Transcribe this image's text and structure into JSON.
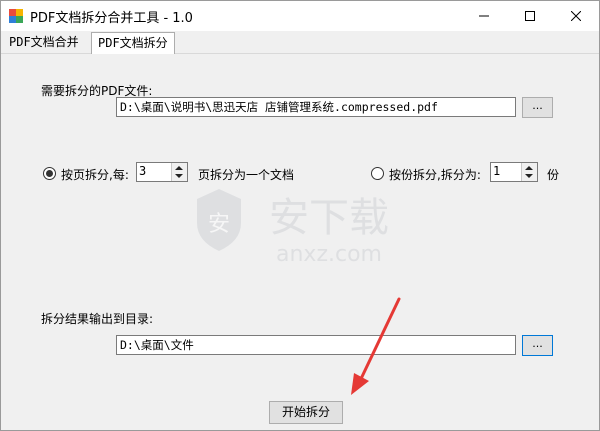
{
  "window": {
    "title": "PDF文档拆分合并工具 - 1.0"
  },
  "tabs": [
    {
      "label": "PDF文档合并",
      "active": false
    },
    {
      "label": "PDF文档拆分",
      "active": true
    }
  ],
  "source": {
    "label": "需要拆分的PDF文件:",
    "value": "D:\\桌面\\说明书\\思迅天店 店铺管理系统.compressed.pdf",
    "browse_label": "..."
  },
  "split_by_page": {
    "label": "按页拆分,每:",
    "value": "3",
    "suffix": "页拆分为一个文档",
    "checked": true
  },
  "split_by_parts": {
    "label": "按份拆分,拆分为:",
    "value": "1",
    "suffix": "份",
    "checked": false
  },
  "output": {
    "label": "拆分结果输出到目录:",
    "value": "D:\\桌面\\文件",
    "browse_label": "..."
  },
  "start_label": "开始拆分",
  "watermark": {
    "brand": "安下载",
    "domain": "anxz.com"
  },
  "colors": {
    "arrow": "#e53935",
    "focus": "#0078d7"
  }
}
